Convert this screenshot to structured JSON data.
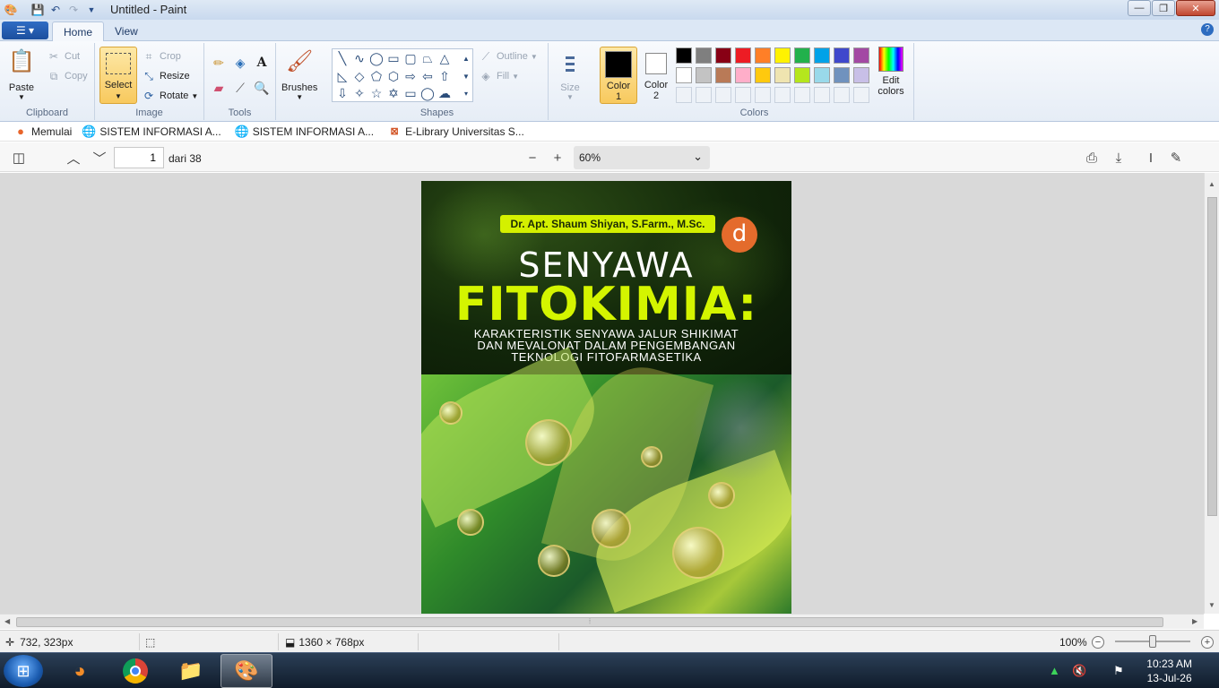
{
  "window": {
    "title": "Untitled - Paint",
    "minimize": "—",
    "maximize": "❐",
    "close": "✕"
  },
  "ribbon": {
    "tabs": [
      {
        "label": "Home"
      },
      {
        "label": "View"
      }
    ],
    "clipboard": {
      "group_label": "Clipboard",
      "paste": "Paste",
      "cut": "Cut",
      "copy": "Copy"
    },
    "image": {
      "group_label": "Image",
      "select": "Select",
      "crop": "Crop",
      "resize": "Resize",
      "rotate": "Rotate"
    },
    "tools": {
      "group_label": "Tools"
    },
    "brushes": {
      "label": "Brushes"
    },
    "shapes": {
      "group_label": "Shapes",
      "outline": "Outline",
      "fill": "Fill"
    },
    "size": {
      "label": "Size"
    },
    "colors": {
      "group_label": "Colors",
      "color1": "Color 1",
      "color2": "Color 2",
      "edit_colors": "Edit colors",
      "color1_value": "#000000",
      "color2_value": "#ffffff",
      "palette_row1": [
        "#000000",
        "#7f7f7f",
        "#880015",
        "#ed1c24",
        "#ff7f27",
        "#fff200",
        "#22b14c",
        "#00a2e8",
        "#3f48cc",
        "#a349a4"
      ],
      "palette_row2": [
        "#ffffff",
        "#c3c3c3",
        "#b97a57",
        "#ffaec9",
        "#ffc90e",
        "#efe4b0",
        "#b5e61d",
        "#99d9ea",
        "#7092be",
        "#c8bfe7"
      ]
    }
  },
  "bookmarks": [
    {
      "label": "Memulai",
      "icon": "firefox-icon"
    },
    {
      "label": "SISTEM INFORMASI A...",
      "icon": "globe-icon"
    },
    {
      "label": "SISTEM INFORMASI A...",
      "icon": "globe-icon"
    },
    {
      "label": "E-Library Universitas S...",
      "icon": "library-icon"
    }
  ],
  "pdf_toolbar": {
    "page_current": "1",
    "page_total_label": "dari 38",
    "zoom": "60%"
  },
  "cover": {
    "author": "Dr. Apt. Shaum Shiyan, S.Farm., M.Sc.",
    "publisher_mark": "d",
    "title_line1": "SENYAWA",
    "title_line2": "FITOKIMIA:",
    "subtitle_line1": "KARAKTERISTIK SENYAWA JALUR SHIKIMAT",
    "subtitle_line2": "DAN MEVALONAT DALAM PENGEMBANGAN",
    "subtitle_line3": "TEKNOLOGI FITOFARMASETIKA"
  },
  "statusbar": {
    "cursor_pos": "732, 323px",
    "image_size": "1360 × 768px",
    "zoom": "100%"
  },
  "taskbar": {
    "time": "10:23 AM",
    "date": "13-Jul-26"
  }
}
